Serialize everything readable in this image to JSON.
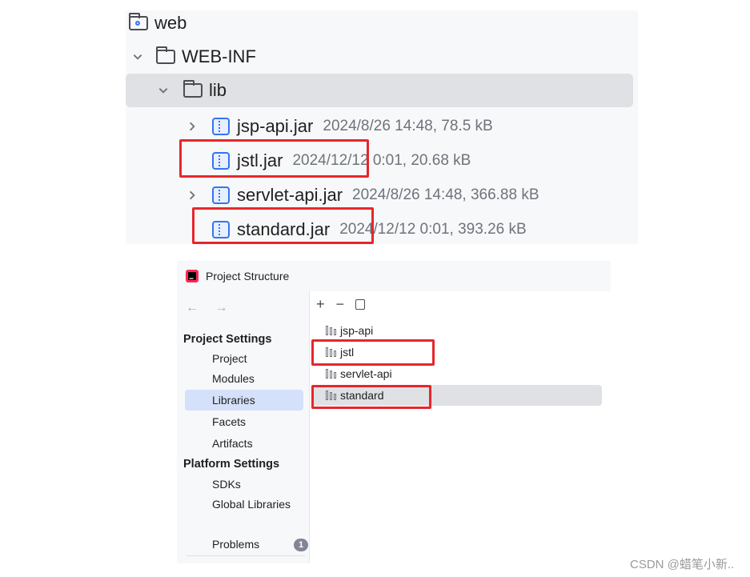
{
  "file_tree": {
    "items": [
      {
        "name": "web",
        "meta": "",
        "icon": "web-module-folder-icon"
      },
      {
        "name": "WEB-INF",
        "meta": "",
        "icon": "folder-icon"
      },
      {
        "name": "lib",
        "meta": "",
        "icon": "folder-icon"
      },
      {
        "name": "jsp-api.jar",
        "meta": "2024/8/26 14:48, 78.5 kB",
        "icon": "jar-icon"
      },
      {
        "name": "jstl.jar",
        "meta": "2024/12/12 0:01, 20.68 kB",
        "icon": "jar-icon"
      },
      {
        "name": "servlet-api.jar",
        "meta": "2024/8/26 14:48, 366.88 kB",
        "icon": "jar-icon"
      },
      {
        "name": "standard.jar",
        "meta": "2024/12/12 0:01, 393.26 kB",
        "icon": "jar-icon"
      }
    ]
  },
  "project_structure": {
    "title": "Project Structure",
    "nav_arrows": "← →",
    "project_settings": {
      "heading": "Project Settings",
      "items": [
        "Project",
        "Modules",
        "Libraries",
        "Facets",
        "Artifacts"
      ]
    },
    "platform_settings": {
      "heading": "Platform Settings",
      "items": [
        "SDKs",
        "Global Libraries"
      ]
    },
    "problems": {
      "label": "Problems",
      "count": "1"
    },
    "toolbar": {
      "add": "+",
      "remove": "−"
    },
    "libraries": [
      "jsp-api",
      "jstl",
      "servlet-api",
      "standard"
    ]
  },
  "watermark": "CSDN @蜡笔小新..",
  "colors": {
    "highlight": "#e5272c",
    "accent": "#3574f0",
    "selection": "#d5e1fb"
  }
}
